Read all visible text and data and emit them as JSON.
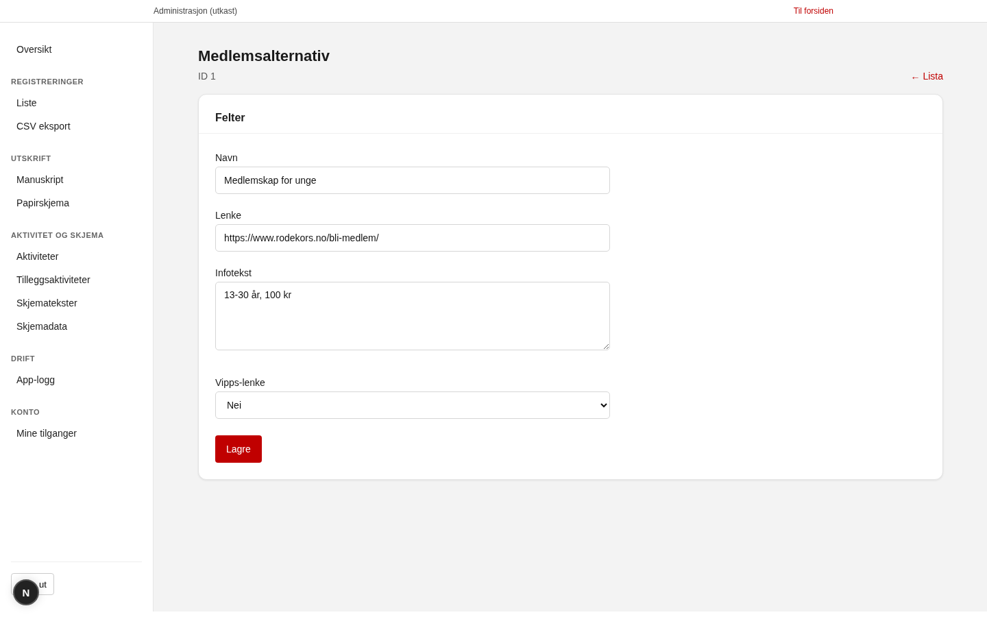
{
  "header": {
    "title": "Administrasjon (utkast)",
    "home_link": "Til forsiden"
  },
  "sidebar": {
    "sections": [
      {
        "items": [
          {
            "label": "Oversikt",
            "selected": false
          }
        ]
      },
      {
        "heading": "REGISTRERINGER",
        "items": [
          {
            "label": "Liste",
            "selected": false
          },
          {
            "label": "CSV eksport",
            "selected": false
          }
        ]
      },
      {
        "heading": "UTSKRIFT",
        "items": [
          {
            "label": "Manuskript",
            "selected": false
          },
          {
            "label": "Papirskjema",
            "selected": false
          }
        ]
      },
      {
        "heading": "AKTIVITET OG SKJEMA",
        "items": [
          {
            "label": "Aktiviteter",
            "selected": false
          },
          {
            "label": "Tilleggsaktiviteter",
            "selected": false
          },
          {
            "label": "Skjematekster",
            "selected": false
          },
          {
            "label": "Skjemadata",
            "selected": false
          }
        ]
      },
      {
        "heading": "DRIFT",
        "items": [
          {
            "label": "App-logg",
            "selected": false
          }
        ]
      },
      {
        "heading": "KONTO",
        "items": [
          {
            "label": "Mine tilganger",
            "selected": false
          }
        ]
      }
    ],
    "logout_button": "ut",
    "dev_badge": "N"
  },
  "page": {
    "title": "Medlemsalternativ",
    "subtitle": "ID 1",
    "back_link": "← Lista"
  },
  "card": {
    "title": "Felter",
    "fields": [
      {
        "kind": "text",
        "label": "Navn",
        "value": "Medlemskap for unge"
      },
      {
        "kind": "text",
        "label": "Lenke",
        "value": "https://www.rodekors.no/bli-medlem/"
      },
      {
        "kind": "textarea",
        "label": "Infotekst",
        "value": "13-30 år, 100 kr"
      },
      {
        "kind": "select",
        "label": "Vipps-lenke",
        "value": "Nei"
      }
    ],
    "submit": "Lagre"
  }
}
